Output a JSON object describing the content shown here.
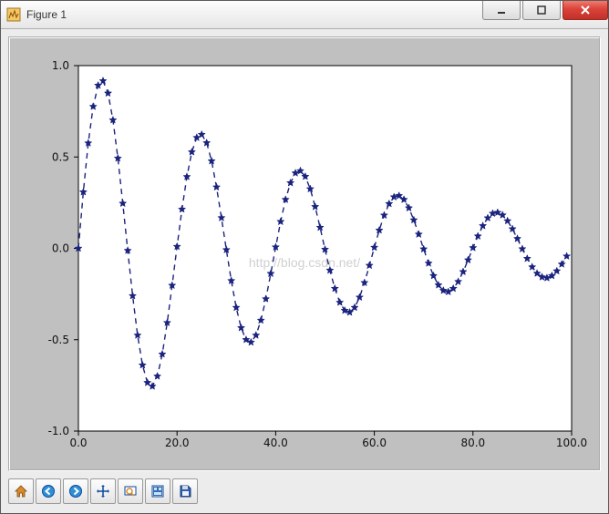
{
  "window": {
    "title": "Figure 1"
  },
  "watermark": "http://blog.csdn.net/",
  "toolbar": {
    "home": "Home",
    "back": "Back",
    "forward": "Forward",
    "pan": "Pan",
    "zoom": "Zoom",
    "config": "Configure subplots",
    "save": "Save"
  },
  "chart_data": {
    "type": "line",
    "marker": "star",
    "linestyle": "dashed",
    "color": "#1a237e",
    "xlabel": "",
    "ylabel": "",
    "xlim": [
      0,
      100
    ],
    "ylim": [
      -1.0,
      1.0
    ],
    "xticks": [
      0.0,
      20.0,
      40.0,
      60.0,
      80.0,
      100.0
    ],
    "yticks": [
      -1.0,
      -0.5,
      0.0,
      0.5,
      1.0
    ],
    "xtick_labels": [
      "0.0",
      "20.0",
      "40.0",
      "60.0",
      "80.0",
      "100.0"
    ],
    "ytick_labels": [
      "-1.0",
      "-0.5",
      "0.0",
      "0.5",
      "1.0"
    ],
    "x": [
      0,
      1,
      2,
      3,
      4,
      5,
      6,
      7,
      8,
      9,
      10,
      11,
      12,
      13,
      14,
      15,
      16,
      17,
      18,
      19,
      20,
      21,
      22,
      23,
      24,
      25,
      26,
      27,
      28,
      29,
      30,
      31,
      32,
      33,
      34,
      35,
      36,
      37,
      38,
      39,
      40,
      41,
      42,
      43,
      44,
      45,
      46,
      47,
      48,
      49,
      50,
      51,
      52,
      53,
      54,
      55,
      56,
      57,
      58,
      59,
      60,
      61,
      62,
      63,
      64,
      65,
      66,
      67,
      68,
      69,
      70,
      71,
      72,
      73,
      74,
      75,
      76,
      77,
      78,
      79,
      80,
      81,
      82,
      83,
      84,
      85,
      86,
      87,
      88,
      89,
      90,
      91,
      92,
      93,
      94,
      95,
      96,
      97,
      98,
      99
    ],
    "y": [
      0.0,
      0.308,
      0.576,
      0.776,
      0.892,
      0.916,
      0.849,
      0.702,
      0.493,
      0.246,
      -0.012,
      -0.26,
      -0.476,
      -0.639,
      -0.735,
      -0.755,
      -0.7,
      -0.579,
      -0.407,
      -0.203,
      0.01,
      0.214,
      0.392,
      0.527,
      0.606,
      0.623,
      0.577,
      0.478,
      0.335,
      0.167,
      -0.008,
      -0.177,
      -0.324,
      -0.435,
      -0.5,
      -0.514,
      -0.476,
      -0.394,
      -0.277,
      -0.138,
      0.007,
      0.146,
      0.267,
      0.358,
      0.412,
      0.424,
      0.393,
      0.325,
      0.228,
      0.114,
      -0.006,
      -0.12,
      -0.22,
      -0.296,
      -0.34,
      -0.35,
      -0.324,
      -0.268,
      -0.188,
      -0.094,
      0.005,
      0.099,
      0.181,
      0.244,
      0.281,
      0.288,
      0.267,
      0.221,
      0.155,
      0.077,
      -0.004,
      -0.082,
      -0.15,
      -0.201,
      -0.231,
      -0.238,
      -0.22,
      -0.182,
      -0.128,
      -0.064,
      0.003,
      0.067,
      0.123,
      0.166,
      0.191,
      0.196,
      0.182,
      0.15,
      0.106,
      0.053,
      -0.003,
      -0.056,
      -0.102,
      -0.137,
      -0.157,
      -0.162,
      -0.15,
      -0.124,
      -0.087,
      -0.043
    ]
  }
}
